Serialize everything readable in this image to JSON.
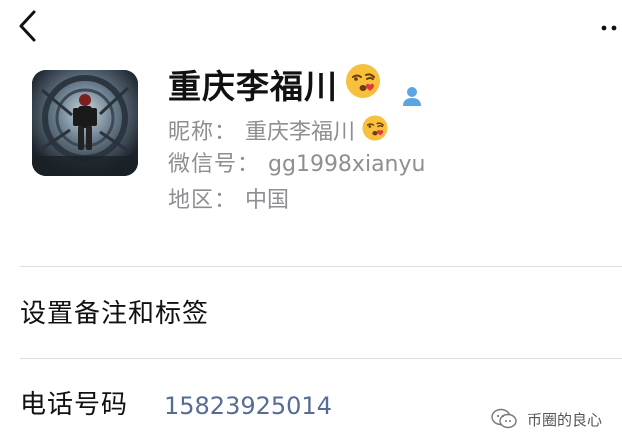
{
  "profile": {
    "display_name": "重庆李福川",
    "nickname_label": "昵称：",
    "nickname_value": "重庆李福川",
    "wechat_id_label": "微信号：",
    "wechat_id_value": "gg1998xianyu",
    "region_label": "地区：",
    "region_value": "中国"
  },
  "sections": {
    "remark_title": "设置备注和标签",
    "phone_title": "电话号码",
    "phone_value": "15823925014"
  },
  "watermark": {
    "text": "币圈的良心"
  },
  "icons": {
    "back": "chevron-left-icon",
    "more": "more-dots-icon",
    "emoji": "kissing-face-emoji",
    "contact": "person-icon"
  },
  "colors": {
    "link": "#576b95",
    "secondary_text": "#8e8e93",
    "contact_icon": "#5aa6e3"
  }
}
